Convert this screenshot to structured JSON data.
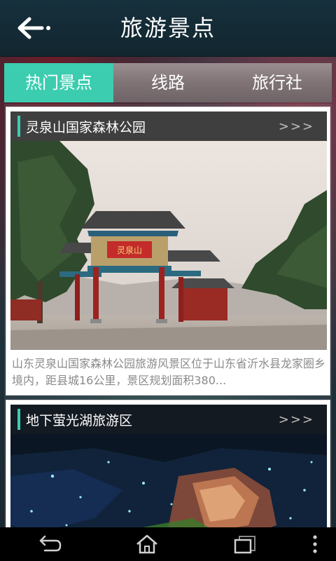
{
  "header": {
    "title": "旅游景点"
  },
  "tabs": [
    {
      "label": "热门景点",
      "active": true
    },
    {
      "label": "线路",
      "active": false
    },
    {
      "label": "旅行社",
      "active": false
    }
  ],
  "cards": [
    {
      "name": "灵泉山国家森林公园",
      "more": ">>>",
      "description": "山东灵泉山国家森林公园旅游风景区位于山东省沂水县龙家圈乡境内，距县城16公里，景区规划面积380...",
      "gate_plaque": "灵泉山"
    },
    {
      "name": "地下萤光湖旅游区",
      "more": ">>>"
    }
  ],
  "colors": {
    "accent": "#3ccdb0",
    "card_header": "#3f3f3f",
    "titlebar": "#14303c"
  },
  "icons": {
    "back": "arrow-left-icon",
    "nav_back": "back-icon",
    "nav_home": "home-icon",
    "nav_recents": "recents-icon",
    "nav_menu": "overflow-menu-icon"
  }
}
